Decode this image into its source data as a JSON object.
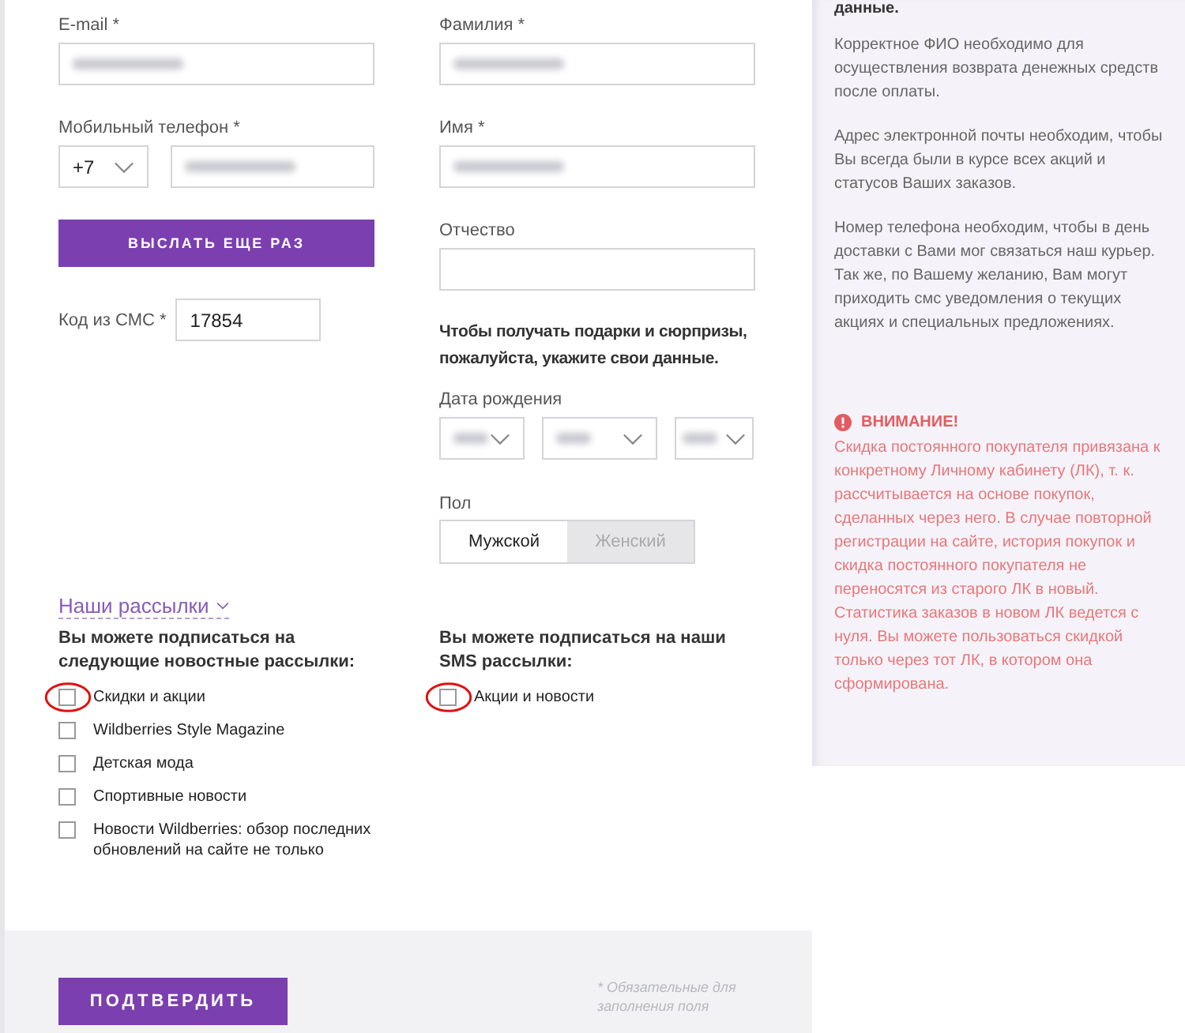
{
  "left_fields": [
    {
      "label": "E-mail *",
      "blurred": true
    },
    {
      "label": "Мобильный телефон *",
      "country_code": "+7",
      "blurred": true
    }
  ],
  "resend_button": "ВЫСЛАТЬ ЕЩЕ РАЗ",
  "sms_code": {
    "label": "Код из СМС *",
    "value": "17854"
  },
  "right_fields": [
    {
      "label": "Фамилия *",
      "blurred": true
    },
    {
      "label": "Имя *",
      "blurred": true
    },
    {
      "label": "Отчество",
      "blurred": false
    }
  ],
  "gift_note": "Чтобы получать подарки и сюрпризы, пожалуйста, укажите свои данные.",
  "birth_date": {
    "label": "Дата рождения",
    "selects": [
      {
        "blurred": true
      },
      {
        "blurred": true
      },
      {
        "blurred": true
      }
    ]
  },
  "gender": {
    "label": "Пол",
    "options": [
      {
        "label": "Мужской",
        "selected": true
      },
      {
        "label": "Женский",
        "selected": false
      }
    ]
  },
  "subscriptions": {
    "link": "Наши рассылки",
    "groups": [
      {
        "heading": "Вы можете подписаться на следующие новостные рассылки:",
        "options": [
          {
            "label": "Скидки и акции",
            "checked": false,
            "highlighted": true
          },
          {
            "label": "Wildberries Style Magazine",
            "checked": false,
            "highlighted": false
          },
          {
            "label": "Детская мода",
            "checked": false,
            "highlighted": false
          },
          {
            "label": "Спортивные новости",
            "checked": false,
            "highlighted": false
          },
          {
            "label": "Новости Wildberries: обзор последних обновлений на сайте не только",
            "checked": false,
            "highlighted": false
          }
        ]
      },
      {
        "heading": "Вы можете подписаться на наши SMS рассылки:",
        "options": [
          {
            "label": "Акции и новости",
            "checked": false,
            "highlighted": true
          }
        ]
      }
    ]
  },
  "confirm_button": "ПОДТВЕРДИТЬ",
  "required_note": "* Обязательные для заполнения поля",
  "sidebar": {
    "top_fragment": "данные.",
    "paragraphs": [
      "Корректное ФИО необходимо для осуществления возврата денежных средств после оплаты.",
      "Адрес электронной почты необходим, чтобы Вы всегда были в курсе всех акций и статусов Ваших заказов.",
      "Номер телефона необходим, чтобы в день доставки с Вами мог связаться наш курьер. Так же, по Вашему желанию, Вам могут приходить смс уведомления о текущих акциях и специальных предложениях."
    ],
    "warning": {
      "title": "ВНИМАНИЕ!",
      "text": "Скидка постоянного покупателя привязана к конкретному Личному кабинету (ЛК), т. к. рассчитывается на основе покупок, сделанных через него. В случае повторной регистрации на сайте, история покупок и скидка постоянного покупателя не переносятся из старого ЛК в новый. Статистика заказов в новом ЛК ведется с нуля. Вы можете пользоваться скидкой только через тот ЛК, в котором она сформирована."
    }
  }
}
